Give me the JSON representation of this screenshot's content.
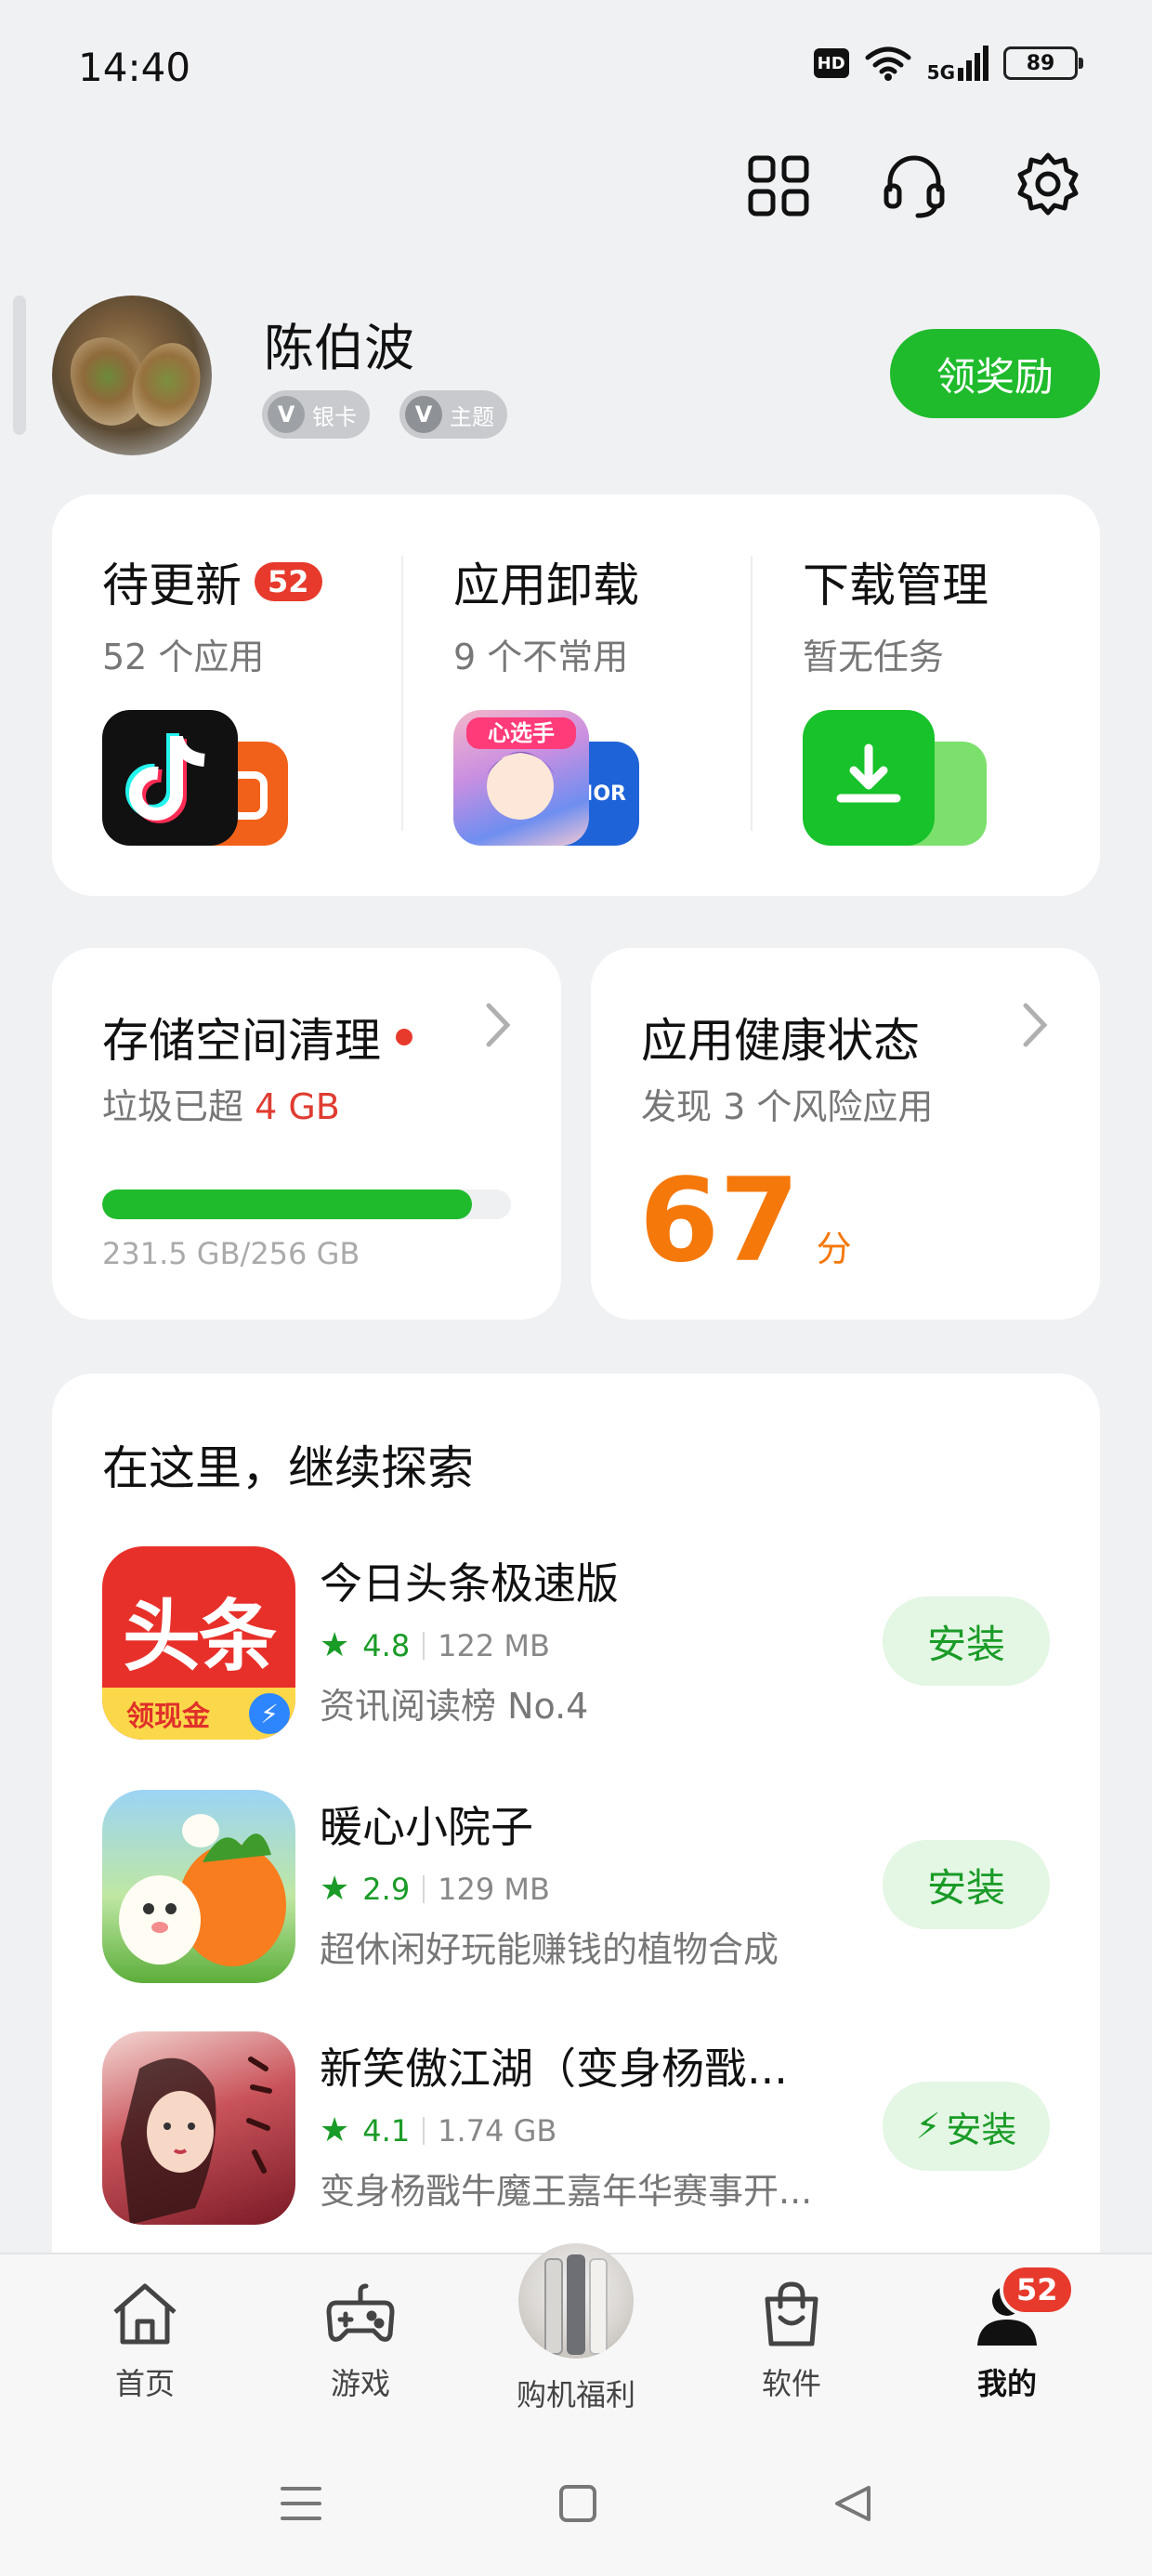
{
  "status_bar": {
    "time": "14:40",
    "hd": "HD",
    "network": "5G",
    "battery": "89"
  },
  "profile": {
    "name": "陈伯波",
    "badge_card": "银卡",
    "badge_theme": "主题",
    "reward_button": "领奖励"
  },
  "quick": {
    "update": {
      "title": "待更新",
      "count": "52",
      "sub": "52 个应用"
    },
    "uninstall": {
      "title": "应用卸载",
      "sub": "9 个不常用"
    },
    "download": {
      "title": "下载管理",
      "sub": "暂无任务"
    }
  },
  "storage": {
    "title": "存储空间清理",
    "sub_prefix": "垃圾已超",
    "sub_value": "4 GB",
    "usage": "231.5 GB/256 GB",
    "used_fraction": 0.904
  },
  "health": {
    "title": "应用健康状态",
    "sub": "发现 3 个风险应用",
    "score": "67",
    "unit": "分"
  },
  "explore": {
    "title": "在这里，继续探索",
    "apps": [
      {
        "name": "今日头条极速版",
        "rating": "4.8",
        "size": "122 MB",
        "desc": "资讯阅读榜 No.4",
        "button": "安装",
        "icon_text": "头条",
        "icon_sub": "领现金"
      },
      {
        "name": "暖心小院子",
        "rating": "2.9",
        "size": "129 MB",
        "desc": "超休闲好玩能赚钱的植物合成",
        "button": "安装"
      },
      {
        "name": "新笑傲江湖（变身杨戬...",
        "rating": "4.1",
        "size": "1.74 GB",
        "desc": "变身杨戬牛魔王嘉年华赛事开...",
        "button": "安装"
      }
    ]
  },
  "nav": {
    "home": "首页",
    "games": "游戏",
    "deals": "购机福利",
    "software": "软件",
    "mine": "我的",
    "mine_badge": "52"
  },
  "colors": {
    "accent_green": "#1fbb2c",
    "badge_red": "#e73a2c",
    "score_orange": "#f5780b"
  }
}
